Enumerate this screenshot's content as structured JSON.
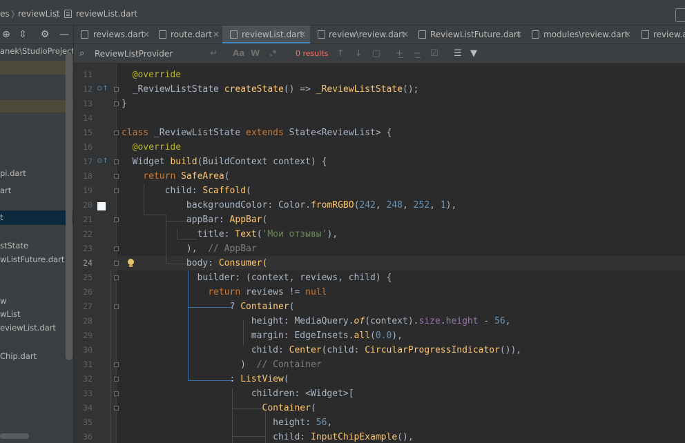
{
  "breadcrumb": {
    "items": [
      "es",
      "reviewList",
      "reviewList.dart"
    ]
  },
  "sidebar": {
    "path_label": "anek\\StudioProjects",
    "items": [
      "pi.dart",
      "art",
      "t",
      "stState",
      "wListFuture.dart",
      "w",
      "wList",
      "eviewList.dart",
      "Chip.dart"
    ]
  },
  "tabs": [
    {
      "label": "reviews.dart"
    },
    {
      "label": "route.dart"
    },
    {
      "label": "reviewList.dart",
      "active": true
    },
    {
      "label": "review\\review.dart"
    },
    {
      "label": "ReviewListFuture.dart"
    },
    {
      "label": "modules\\review.dart"
    },
    {
      "label": "review.ap"
    }
  ],
  "search": {
    "value": "ReviewListProvider",
    "case_label": "Aa",
    "word_label": "W",
    "regex_label": ".*",
    "results": "0 results"
  },
  "editor": {
    "line_numbers": [
      "11",
      "12",
      "13",
      "14",
      "15",
      "16",
      "17",
      "18",
      "19",
      "20",
      "21",
      "22",
      "23",
      "24",
      "25",
      "26",
      "27",
      "28",
      "29",
      "30",
      "31",
      "32",
      "33",
      "34",
      "35",
      "36"
    ],
    "current_line": "24"
  },
  "colors": {
    "keyword": "#cc7832",
    "annotation": "#bbb529",
    "function": "#ffc66d",
    "number": "#6897bb",
    "string": "#6a8759",
    "comment": "#808080",
    "accent": "#4a88c7",
    "results": "#ff6b68"
  }
}
